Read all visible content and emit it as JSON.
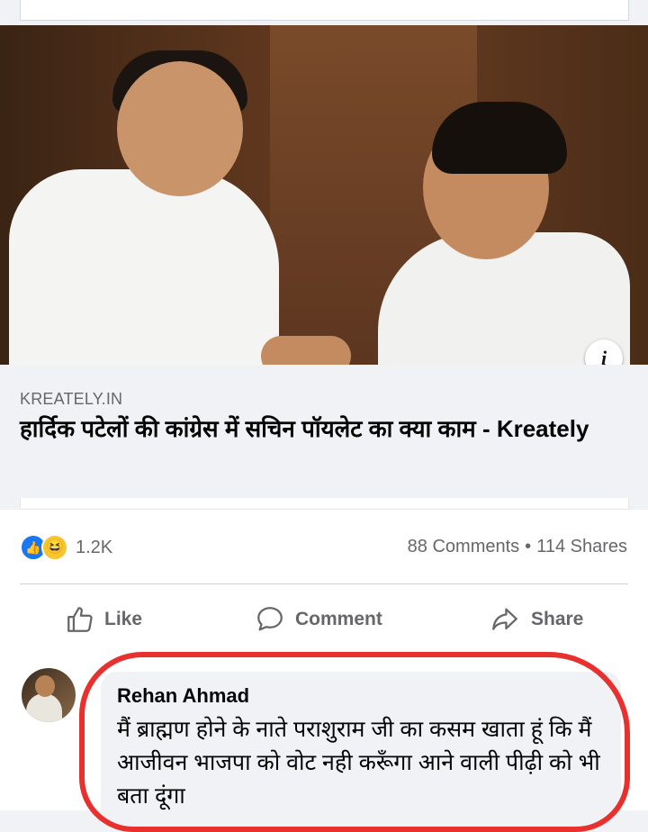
{
  "previous_card": {
    "fragment": ""
  },
  "link_preview": {
    "domain": "KREATELY.IN",
    "headline": "हार्दिक पटेलों की कांग्रेस में सचिन पॉयलेट का क्या काम - Kreately",
    "info_icon": "i"
  },
  "reactions": {
    "icons": [
      "like-icon",
      "haha-icon"
    ],
    "count": "1.2K",
    "comments": "88 Comments",
    "separator": "•",
    "shares": "114 Shares"
  },
  "actions": {
    "like_label": "Like",
    "comment_label": "Comment",
    "share_label": "Share"
  },
  "comment": {
    "author": "Rehan Ahmad",
    "text": "मैं ब्राह्मण होने के नाते पराशुराम जी का कसम खाता हूं कि मैं आजीवन भाजपा को वोट नही करूँगा आने वाली पीढ़ी को भी बता दूंगा"
  },
  "colors": {
    "accent": "#1877f2",
    "highlight_ring": "#e8302f",
    "muted_text": "#65676b"
  }
}
